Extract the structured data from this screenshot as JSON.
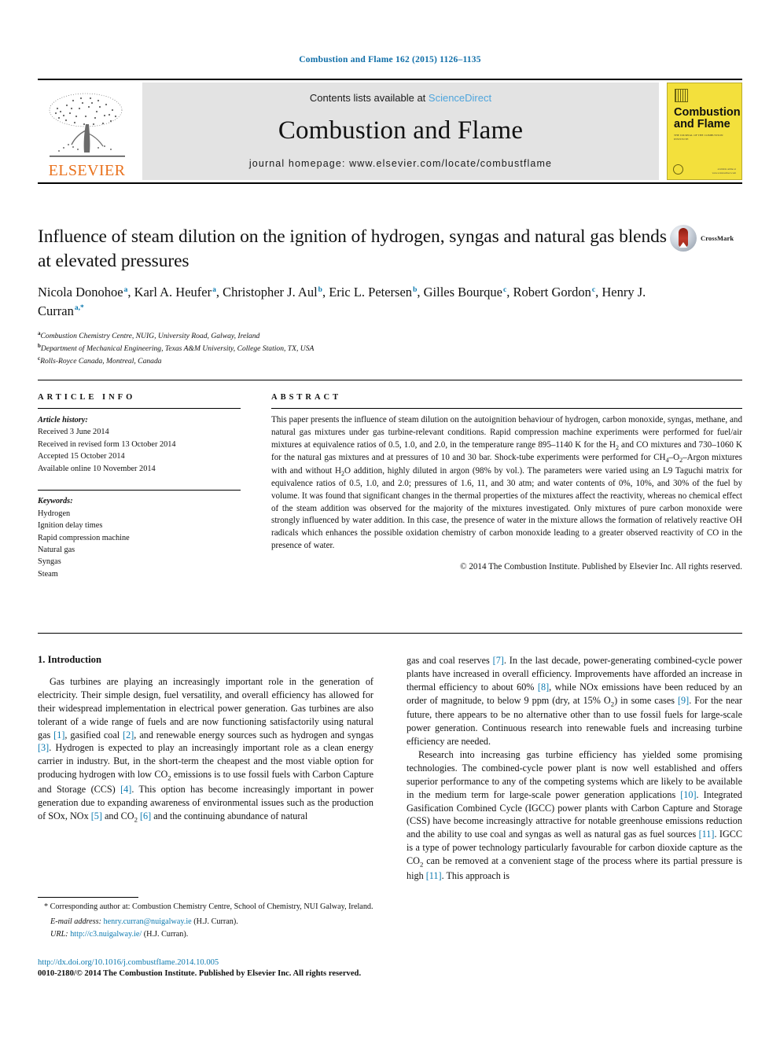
{
  "running_head": "Combustion and Flame 162 (2015) 1126–1135",
  "masthead": {
    "contents_prefix": "Contents lists available at ",
    "sciencedirect": "ScienceDirect",
    "journal_title": "Combustion and Flame",
    "homepage": "journal homepage: www.elsevier.com/locate/combustflame",
    "publisher_wordmark": "ELSEVIER",
    "cover": {
      "title_line1": "Combustion",
      "title_line2": "and Flame",
      "subtitle": "THE JOURNAL OF THE COMBUSTION INSTITUTE",
      "footnote": "available online at www.sciencedirect.com"
    },
    "colors": {
      "band": "#e3e3e3",
      "link": "#4ea5dd",
      "elsevier_orange": "#E9711C",
      "cover_yellow": "#f3e03c"
    }
  },
  "title_block": {
    "title": "Influence of steam dilution on the ignition of hydrogen, syngas and natural gas blends at elevated pressures",
    "crossmark_label": "CrossMark",
    "authors": [
      {
        "name": "Nicola Donohoe",
        "marks": "a",
        "sep": ", "
      },
      {
        "name": "Karl A. Heufer",
        "marks": "a",
        "sep": ", "
      },
      {
        "name": "Christopher J. Aul",
        "marks": "b",
        "sep": ", "
      },
      {
        "name": "Eric L. Petersen",
        "marks": "b",
        "sep": ", "
      },
      {
        "name": "Gilles Bourque",
        "marks": "c",
        "sep": ", "
      },
      {
        "name": "Robert Gordon",
        "marks": "c",
        "sep": ", "
      },
      {
        "name": "Henry J. Curran",
        "marks": "a,*",
        "sep": ""
      }
    ],
    "affiliations": [
      {
        "mark": "a",
        "text": "Combustion Chemistry Centre, NUIG, University Road, Galway, Ireland"
      },
      {
        "mark": "b",
        "text": "Department of Mechanical Engineering, Texas A&M University, College Station, TX, USA"
      },
      {
        "mark": "c",
        "text": "Rolls-Royce Canada, Montreal, Canada"
      }
    ]
  },
  "article_info": {
    "heading": "ARTICLE INFO",
    "history_label": "Article history:",
    "history": [
      "Received 3 June 2014",
      "Received in revised form 13 October 2014",
      "Accepted 15 October 2014",
      "Available online 10 November 2014"
    ],
    "keywords_label": "Keywords:",
    "keywords": [
      "Hydrogen",
      "Ignition delay times",
      "Rapid compression machine",
      "Natural gas",
      "Syngas",
      "Steam"
    ]
  },
  "abstract": {
    "heading": "ABSTRACT",
    "text": "This paper presents the influence of steam dilution on the autoignition behaviour of hydrogen, carbon monoxide, syngas, methane, and natural gas mixtures under gas turbine-relevant conditions. Rapid compression machine experiments were performed for fuel/air mixtures at equivalence ratios of 0.5, 1.0, and 2.0, in the temperature range 895–1140 K for the H2 and CO mixtures and 730–1060 K for the natural gas mixtures and at pressures of 10 and 30 bar. Shock-tube experiments were performed for CH4–O2–Argon mixtures with and without H2O addition, highly diluted in argon (98% by vol.). The parameters were varied using an L9 Taguchi matrix for equivalence ratios of 0.5, 1.0, and 2.0; pressures of 1.6, 11, and 30 atm; and water contents of 0%, 10%, and 30% of the fuel by volume. It was found that significant changes in the thermal properties of the mixtures affect the reactivity, whereas no chemical effect of the steam addition was observed for the majority of the mixtures investigated. Only mixtures of pure carbon monoxide were strongly influenced by water addition. In this case, the presence of water in the mixture allows the formation of relatively reactive OH radicals which enhances the possible oxidation chemistry of carbon monoxide leading to a greater observed reactivity of CO in the presence of water.",
    "copyright": "© 2014 The Combustion Institute. Published by Elsevier Inc. All rights reserved."
  },
  "body": {
    "section_title": "1. Introduction",
    "left_paragraph_1": "Gas turbines are playing an increasingly important role in the generation of electricity. Their simple design, fuel versatility, and overall efficiency has allowed for their widespread implementation in electrical power generation. Gas turbines are also tolerant of a wide range of fuels and are now functioning satisfactorily using natural gas [1], gasified coal [2], and renewable energy sources such as hydrogen and syngas [3]. Hydrogen is expected to play an increasingly important role as a clean energy carrier in industry. But, in the short-term the cheapest and the most viable option for producing hydrogen with low CO2 emissions is to use fossil fuels with Carbon Capture and Storage (CCS) [4]. This option has become increasingly important in power generation due to expanding awareness of environmental issues such as the production of SOx, NOx [5] and CO2 [6] and the continuing abundance of natural",
    "right_paragraph_1": "gas and coal reserves [7]. In the last decade, power-generating combined-cycle power plants have increased in overall efficiency. Improvements have afforded an increase in thermal efficiency to about 60% [8], while NOx emissions have been reduced by an order of magnitude, to below 9 ppm (dry, at 15% O2) in some cases [9]. For the near future, there appears to be no alternative other than to use fossil fuels for large-scale power generation. Continuous research into renewable fuels and increasing turbine efficiency are needed.",
    "right_paragraph_2": "Research into increasing gas turbine efficiency has yielded some promising technologies. The combined-cycle power plant is now well established and offers superior performance to any of the competing systems which are likely to be available in the medium term for large-scale power generation applications [10]. Integrated Gasification Combined Cycle (IGCC) power plants with Carbon Capture and Storage (CSS) have become increasingly attractive for notable greenhouse emissions reduction and the ability to use coal and syngas as well as natural gas as fuel sources [11]. IGCC is a type of power technology particularly favourable for carbon dioxide capture as the CO2 can be removed at a convenient stage of the process where its partial pressure is high [11]. This approach is"
  },
  "footnote": {
    "corresponding": "* Corresponding author at: Combustion Chemistry Centre, School of Chemistry, NUI Galway, Ireland.",
    "email_label": "E-mail address:",
    "email": "henry.curran@nuigalway.ie",
    "email_owner": "(H.J. Curran).",
    "url_label": "URL:",
    "url": "http://c3.nuigalway.ie/",
    "url_owner": "(H.J. Curran)."
  },
  "page_footer": {
    "doi": "http://dx.doi.org/10.1016/j.combustflame.2014.10.005",
    "issn_line": "0010-2180/© 2014 The Combustion Institute. Published by Elsevier Inc. All rights reserved."
  }
}
